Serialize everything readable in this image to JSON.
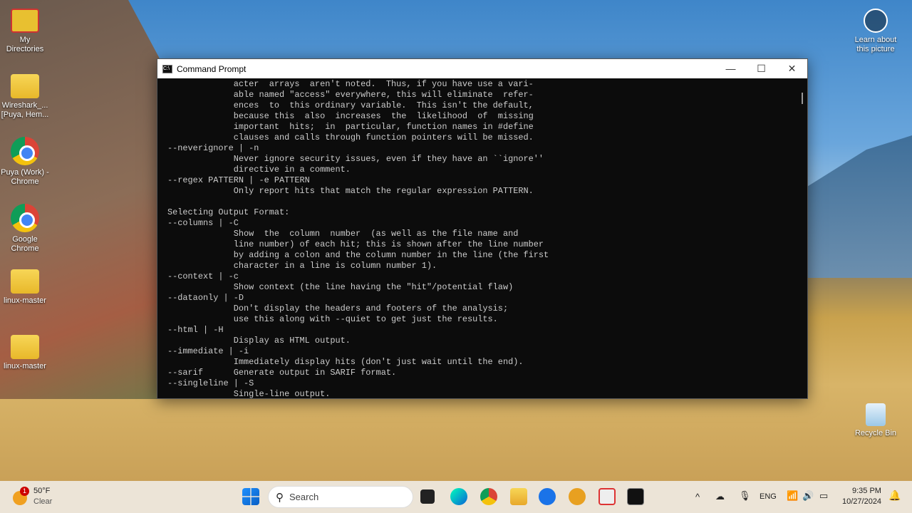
{
  "desktop": {
    "icons": [
      {
        "label": "My Directories",
        "type": "app"
      },
      {
        "label": "Wireshark_... [Puya, Hem...",
        "type": "folder"
      },
      {
        "label": "Puya (Work) - Chrome",
        "type": "chrome"
      },
      {
        "label": "Google Chrome",
        "type": "chrome"
      },
      {
        "label": "linux-master",
        "type": "folder"
      },
      {
        "label": "linux-master",
        "type": "folder"
      }
    ],
    "learn": "Learn about this picture",
    "recycle": "Recycle Bin"
  },
  "window": {
    "title": "Command Prompt",
    "minimize": "—",
    "maximize": "☐",
    "close": "✕"
  },
  "terminal": {
    "lines": [
      "             acter  arrays  aren't noted.  Thus, if you have use a vari-",
      "             able named \"access\" everywhere, this will eliminate  refer-",
      "             ences  to  this ordinary variable.  This isn't the default,",
      "             because this  also  increases  the  likelihood  of  missing",
      "             important  hits;  in  particular, function names in #define",
      "             clauses and calls through function pointers will be missed.",
      "--neverignore | -n",
      "             Never ignore security issues, even if they have an ``ignore''",
      "             directive in a comment.",
      "--regex PATTERN | -e PATTERN",
      "             Only report hits that match the regular expression PATTERN.",
      "",
      "Selecting Output Format:",
      "--columns | -C",
      "             Show  the  column  number  (as well as the file name and",
      "             line number) of each hit; this is shown after the line number",
      "             by adding a colon and the column number in the line (the first",
      "             character in a line is column number 1).",
      "--context | -c",
      "             Show context (the line having the \"hit\"/potential flaw)",
      "--dataonly | -D",
      "             Don't display the headers and footers of the analysis;",
      "             use this along with --quiet to get just the results.",
      "--html | -H",
      "             Display as HTML output.",
      "--immediate | -i",
      "             Immediately display hits (don't just wait until the end).",
      "--sarif      Generate output in SARIF format.",
      "--singleline | -S",
      "             Single-line output."
    ]
  },
  "taskbar": {
    "weather_temp": "50°F",
    "weather_desc": "Clear",
    "weather_badge": "1",
    "search_placeholder": "Search",
    "lang": "ENG",
    "time": "9:35 PM",
    "date": "10/27/2024"
  }
}
